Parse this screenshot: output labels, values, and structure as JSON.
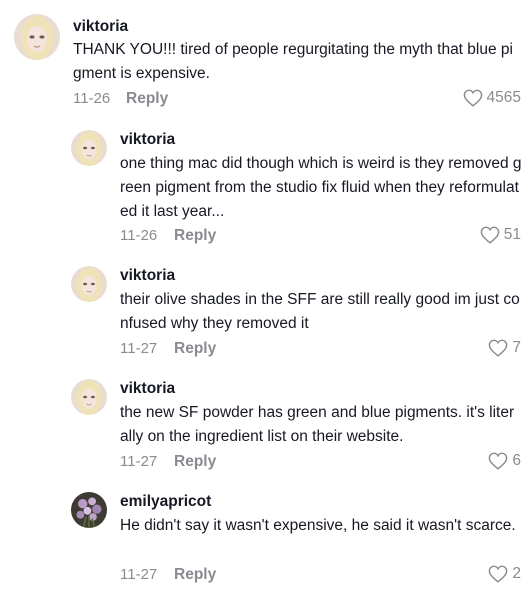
{
  "comments": [
    {
      "username": "viktoria",
      "text": "THANK YOU!!! tired of people regurgitating the myth that blue pigment is expensive.",
      "date": "11-26",
      "reply_label": "Reply",
      "likes": "4565",
      "avatar": "blonde-avatar"
    },
    {
      "username": "viktoria",
      "text": "one thing mac did though which is weird is they removed green pigment from the studio fix fluid when they reformulated it last year...",
      "date": "11-26",
      "reply_label": "Reply",
      "likes": "51",
      "avatar": "blonde-avatar"
    },
    {
      "username": "viktoria",
      "text": "their olive shades in the SFF are still really good im just confused why they removed it",
      "date": "11-27",
      "reply_label": "Reply",
      "likes": "7",
      "avatar": "blonde-avatar"
    },
    {
      "username": "viktoria",
      "text": "the new SF powder has green and blue pigments. it's literally on the ingredient list on their website.",
      "date": "11-27",
      "reply_label": "Reply",
      "likes": "6",
      "avatar": "blonde-avatar"
    },
    {
      "username": "emilyapricot",
      "text": "He didn't say it wasn't expensive, he said it wasn't scarce.",
      "date": "11-27",
      "reply_label": "Reply",
      "likes": "2",
      "avatar": "flowers-avatar"
    }
  ]
}
